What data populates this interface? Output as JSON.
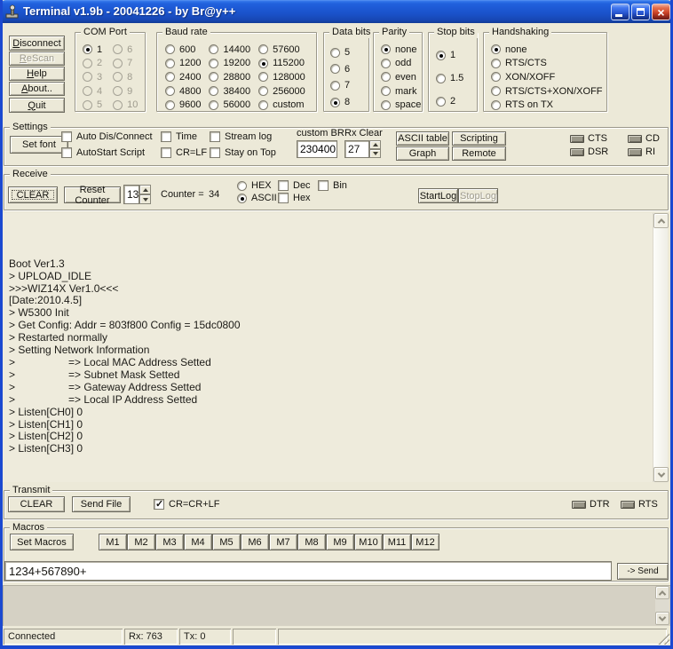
{
  "window": {
    "title": "Terminal v1.9b - 20041226 - by Br@y++"
  },
  "icons": {
    "app": "joystick-terminal-icon",
    "minimize_glyph": "_",
    "maximize_glyph": "□",
    "close_glyph": "×",
    "spin_up": "triangle-up",
    "spin_down": "triangle-down",
    "scroll_up": "chevron-up",
    "scroll_down": "chevron-down",
    "check": "✓"
  },
  "actions": {
    "disconnect": "Disconnect",
    "rescan": "ReScan",
    "help": "Help",
    "about": "About..",
    "quit": "Quit"
  },
  "com_port": {
    "caption": "COM Port",
    "selected": "1",
    "options": [
      {
        "label": "1",
        "selected": true
      },
      {
        "label": "2",
        "disabled": true
      },
      {
        "label": "3",
        "disabled": true
      },
      {
        "label": "4",
        "disabled": true
      },
      {
        "label": "5",
        "disabled": true
      },
      {
        "label": "6",
        "disabled": true
      },
      {
        "label": "7",
        "disabled": true
      },
      {
        "label": "8",
        "disabled": true
      },
      {
        "label": "9",
        "disabled": true
      },
      {
        "label": "10",
        "disabled": true
      }
    ]
  },
  "baud_rate": {
    "caption": "Baud rate",
    "selected": "115200",
    "options": [
      {
        "label": "600"
      },
      {
        "label": "1200"
      },
      {
        "label": "2400"
      },
      {
        "label": "4800"
      },
      {
        "label": "9600"
      },
      {
        "label": "14400"
      },
      {
        "label": "19200"
      },
      {
        "label": "28800"
      },
      {
        "label": "38400"
      },
      {
        "label": "56000"
      },
      {
        "label": "57600"
      },
      {
        "label": "115200",
        "selected": true
      },
      {
        "label": "128000"
      },
      {
        "label": "256000"
      },
      {
        "label": "custom"
      }
    ]
  },
  "data_bits": {
    "caption": "Data bits",
    "selected": "8",
    "options": [
      {
        "label": "5"
      },
      {
        "label": "6"
      },
      {
        "label": "7"
      },
      {
        "label": "8",
        "selected": true
      }
    ]
  },
  "parity": {
    "caption": "Parity",
    "selected": "none",
    "options": [
      {
        "label": "none",
        "selected": true
      },
      {
        "label": "odd"
      },
      {
        "label": "even"
      },
      {
        "label": "mark"
      },
      {
        "label": "space"
      }
    ]
  },
  "stop_bits": {
    "caption": "Stop bits",
    "selected": "1",
    "options": [
      {
        "label": "1",
        "selected": true
      },
      {
        "label": "1.5"
      },
      {
        "label": "2"
      }
    ]
  },
  "handshaking": {
    "caption": "Handshaking",
    "selected": "none",
    "options": [
      {
        "label": "none",
        "selected": true
      },
      {
        "label": "RTS/CTS"
      },
      {
        "label": "XON/XOFF"
      },
      {
        "label": "RTS/CTS+XON/XOFF"
      },
      {
        "label": "RTS on TX"
      }
    ]
  },
  "settings": {
    "caption": "Settings",
    "set_font": "Set font",
    "auto_disconnect": "Auto Dis/Connect",
    "autostart_script": "AutoStart Script",
    "time": "Time",
    "cr_lf": "CR=LF",
    "stream_log": "Stream log",
    "stay_on_top": "Stay on Top",
    "custom_br_label": "custom BR",
    "custom_br_value": "230400",
    "rx_clear_label": "Rx Clear",
    "rx_clear_value": "27",
    "ascii_table": "ASCII table",
    "scripting": "Scripting",
    "graph": "Graph",
    "remote": "Remote",
    "indicators": {
      "cts": "CTS",
      "dsr": "DSR",
      "cd": "CD",
      "ri": "RI"
    }
  },
  "receive": {
    "caption": "Receive",
    "clear": "CLEAR",
    "reset_counter": "Reset Counter",
    "spinner_value": "13",
    "counter_label": "Counter =",
    "counter_value": "34",
    "hex_radio": "HEX",
    "ascii_radio": "ASCII",
    "mode_selected": "ASCII",
    "dec_checkbox": "Dec",
    "hex_checkbox": "Hex",
    "bin_checkbox": "Bin",
    "start_log": "StartLog",
    "stop_log": "StopLog"
  },
  "terminal": {
    "lines": [
      "Boot Ver1.3",
      "> UPLOAD_IDLE",
      ">>>WIZ14X Ver1.0<<<",
      "[Date:2010.4.5]",
      "> W5300 Init",
      "> Get Config: Addr = 803f800 Config = 15dc0800",
      "> Restarted normally",
      "> Setting Network Information",
      ">                  => Local MAC Address Setted",
      ">                  => Subnet Mask Setted",
      ">                  => Gateway Address Setted",
      ">                  => Local IP Address Setted",
      "> Listen[CH0] 0",
      "> Listen[CH1] 0",
      "> Listen[CH2] 0",
      "> Listen[CH3] 0"
    ]
  },
  "transmit": {
    "caption": "Transmit",
    "clear": "CLEAR",
    "send_file": "Send File",
    "cr_crlf": "CR=CR+LF",
    "cr_crlf_checked": true,
    "indicators": {
      "dtr": "DTR",
      "rts": "RTS"
    }
  },
  "macros": {
    "caption": "Macros",
    "set_macros": "Set Macros",
    "buttons": [
      "M1",
      "M2",
      "M3",
      "M4",
      "M5",
      "M6",
      "M7",
      "M8",
      "M9",
      "M10",
      "M11",
      "M12"
    ]
  },
  "send": {
    "value": "1234+567890+",
    "button": "-> Send"
  },
  "status_bar": {
    "connection": "Connected",
    "rx": "Rx: 763",
    "tx": "Tx: 0"
  }
}
